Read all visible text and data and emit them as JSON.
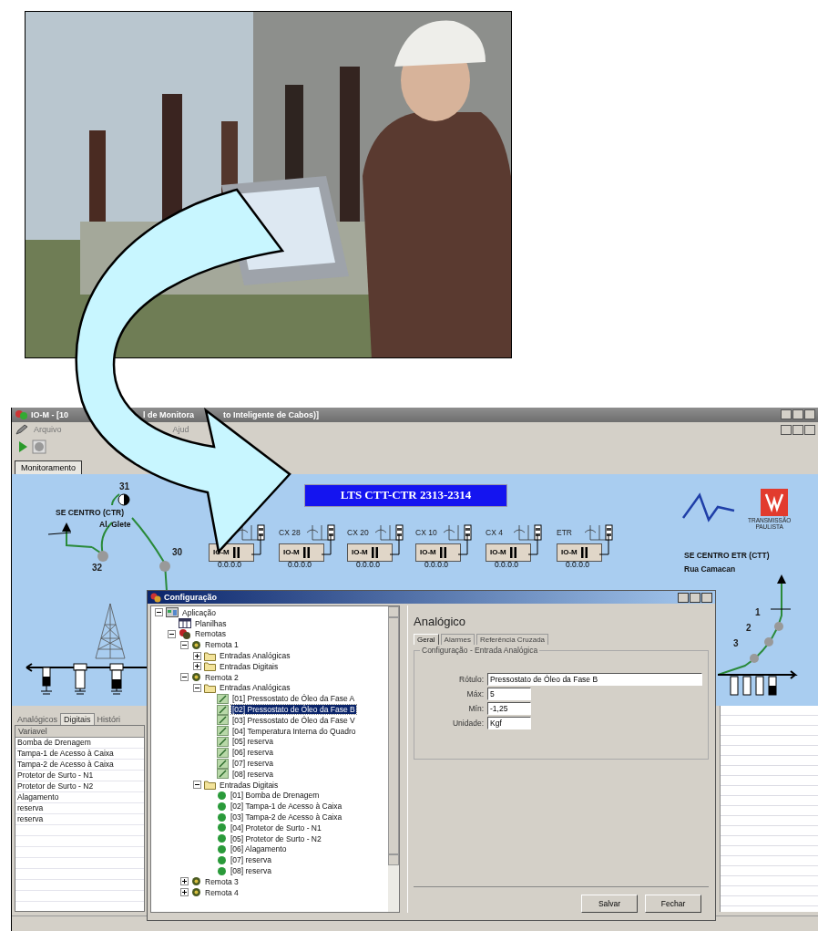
{
  "window": {
    "title_parts": [
      "IO-M - [10",
      "l de Monitora",
      "to Inteligente de Cabos)]"
    ]
  },
  "menu": [
    "Arquivo",
    "Ajud"
  ],
  "tabs": [
    {
      "label": "Monitoramento",
      "selected": true
    }
  ],
  "diagram": {
    "title": "LTS CTT-CTR 2313-2314",
    "left_station": {
      "name": "SE CENTRO (CTR)",
      "street": "Al. Glete"
    },
    "node_labels": [
      "31",
      "32",
      "30"
    ],
    "devices": [
      {
        "module": "IO-M",
        "address": "0.0.0.0"
      },
      {
        "label": "CX 28",
        "module": "IO-M",
        "address": "0.0.0.0"
      },
      {
        "label": "CX 20",
        "module": "IO-M",
        "address": "0.0.0.0"
      },
      {
        "label": "CX 10",
        "module": "IO-M",
        "address": "0.0.0.0"
      },
      {
        "label": "CX 4",
        "module": "IO-M",
        "address": "0.0.0.0"
      },
      {
        "label": "ETR",
        "module": "IO-M",
        "address": "0.0.0.0"
      }
    ],
    "logo_text": [
      "TRANSMISSÃO",
      "PAULISTA"
    ],
    "right_station": {
      "name": "SE CENTRO ETR (CTT)",
      "street": "Rua Camacan"
    },
    "right_labels": [
      "1",
      "2",
      "3"
    ]
  },
  "lower_tabs": [
    {
      "label": "Analógicos",
      "selected": false
    },
    {
      "label": "Digitais",
      "selected": true
    },
    {
      "label": "Históri",
      "selected": false
    }
  ],
  "variables": {
    "column": "Variavel",
    "rows": [
      "Bomba de Drenagem",
      "Tampa-1 de Acesso à Caixa",
      "Tampa-2 de Acesso à Caixa",
      "Protetor de Surto - N1",
      "Protetor de Surto - N2",
      "Alagamento",
      "reserva",
      "reserva"
    ]
  },
  "dialog": {
    "title": "Configuração",
    "tree": [
      {
        "label": "Aplicação",
        "kind": "app",
        "expanded": true,
        "selected": false,
        "children": [
          {
            "label": "Planilhas",
            "kind": "sheet",
            "selected": false
          },
          {
            "label": "Remotas",
            "kind": "remotes",
            "expanded": true,
            "selected": false,
            "children": [
              {
                "label": "Remota 1",
                "kind": "remote",
                "expanded": true,
                "selected": false,
                "children": [
                  {
                    "label": "Entradas Analógicas",
                    "kind": "folder",
                    "expanded": false,
                    "selected": false
                  },
                  {
                    "label": "Entradas Digitais",
                    "kind": "folder",
                    "expanded": false,
                    "selected": false
                  }
                ]
              },
              {
                "label": "Remota 2",
                "kind": "remote",
                "expanded": true,
                "selected": false,
                "children": [
                  {
                    "label": "Entradas Analógicas",
                    "kind": "folder",
                    "expanded": true,
                    "selected": false,
                    "children": [
                      {
                        "label": "[01] Pressostato de Óleo da Fase A",
                        "kind": "analog",
                        "selected": false
                      },
                      {
                        "label": "[02] Pressostato de Óleo da Fase B",
                        "kind": "analog",
                        "selected": true
                      },
                      {
                        "label": "[03] Pressostato de Óleo da Fase V",
                        "kind": "analog",
                        "selected": false
                      },
                      {
                        "label": "[04] Temperatura Interna do Quadro",
                        "kind": "analog",
                        "selected": false
                      },
                      {
                        "label": "[05] reserva",
                        "kind": "analog",
                        "selected": false
                      },
                      {
                        "label": "[06] reserva",
                        "kind": "analog",
                        "selected": false
                      },
                      {
                        "label": "[07] reserva",
                        "kind": "analog",
                        "selected": false
                      },
                      {
                        "label": "[08] reserva",
                        "kind": "analog",
                        "selected": false
                      }
                    ]
                  },
                  {
                    "label": "Entradas Digitais",
                    "kind": "folder",
                    "expanded": true,
                    "selected": false,
                    "children": [
                      {
                        "label": "[01] Bomba de Drenagem",
                        "kind": "digital",
                        "selected": false
                      },
                      {
                        "label": "[02] Tampa-1 de Acesso à Caixa",
                        "kind": "digital",
                        "selected": false
                      },
                      {
                        "label": "[03] Tampa-2 de Acesso à Caixa",
                        "kind": "digital",
                        "selected": false
                      },
                      {
                        "label": "[04] Protetor de Surto - N1",
                        "kind": "digital",
                        "selected": false
                      },
                      {
                        "label": "[05] Protetor de Surto - N2",
                        "kind": "digital",
                        "selected": false
                      },
                      {
                        "label": "[06] Alagamento",
                        "kind": "digital",
                        "selected": false
                      },
                      {
                        "label": "[07] reserva",
                        "kind": "digital",
                        "selected": false
                      },
                      {
                        "label": "[08] reserva",
                        "kind": "digital",
                        "selected": false
                      }
                    ]
                  }
                ]
              },
              {
                "label": "Remota 3",
                "kind": "remote",
                "expanded": false,
                "selected": false
              },
              {
                "label": "Remota 4",
                "kind": "remote",
                "expanded": false,
                "selected": false
              }
            ]
          }
        ]
      }
    ],
    "heading": "Analógico",
    "tabs": [
      {
        "label": "Geral",
        "selected": true
      },
      {
        "label": "Alarmes",
        "selected": false
      },
      {
        "label": "Referência Cruzada",
        "selected": false
      }
    ],
    "group": "Configuração - Entrada Analógica",
    "fields": [
      {
        "label": "Rótulo:",
        "value": "Pressostato de Óleo da Fase B"
      },
      {
        "label": "Máx:",
        "value": "5"
      },
      {
        "label": "Mín:",
        "value": "-1,25"
      },
      {
        "label": "Unidade:",
        "value": "Kgf"
      }
    ],
    "buttons": [
      "Salvar",
      "Fechar"
    ]
  }
}
